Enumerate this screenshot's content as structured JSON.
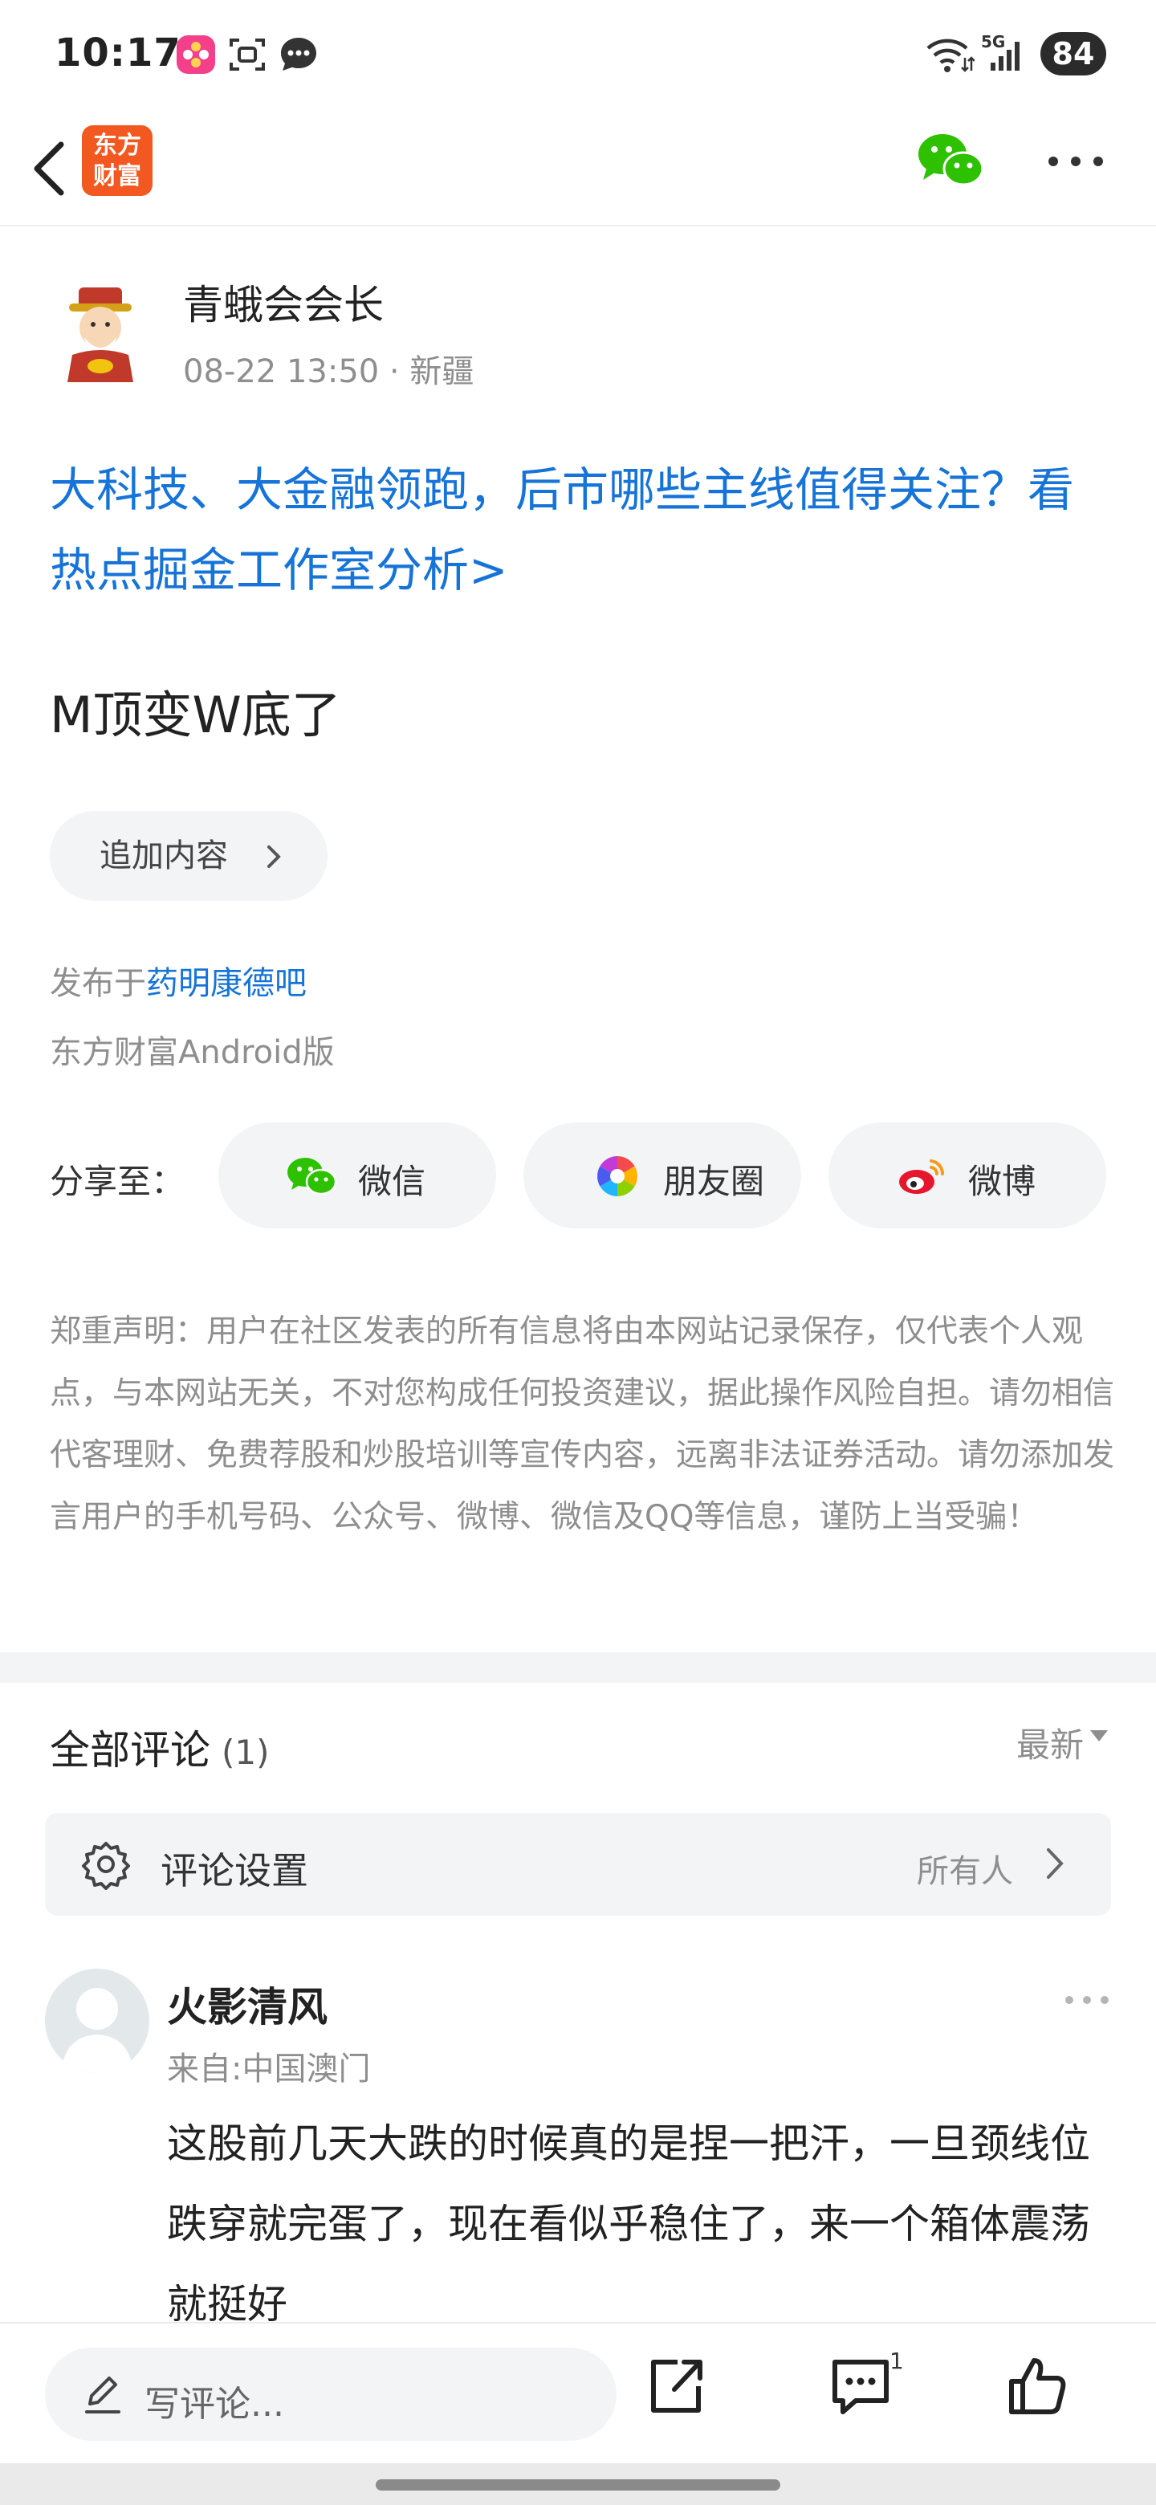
{
  "status_bar": {
    "time": "10:17",
    "network": "5G",
    "battery": "84"
  },
  "nav": {
    "brand_logo_text": "东方财富"
  },
  "post": {
    "author": "青蛾会会长",
    "meta": "08-22 13:50 · 新疆",
    "promo_link": "大科技、大金融领跑，后市哪些主线值得关注？看热点掘金工作室分析>",
    "text": "M顶变W底了",
    "add_content_label": "追加内容",
    "published_prefix": "发布于",
    "forum_name": "药明康德吧",
    "client": "东方财富Android版"
  },
  "share": {
    "label": "分享至：",
    "targets": [
      {
        "label": "微信",
        "icon": "wechat-icon"
      },
      {
        "label": "朋友圈",
        "icon": "moments-icon"
      },
      {
        "label": "微博",
        "icon": "weibo-icon"
      }
    ]
  },
  "disclaimer": "郑重声明：用户在社区发表的所有信息将由本网站记录保存，仅代表个人观点，与本网站无关，不对您构成任何投资建议，据此操作风险自担。请勿相信代客理财、免费荐股和炒股培训等宣传内容，远离非法证券活动。请勿添加发言用户的手机号码、公众号、微博、微信及QQ等信息，谨防上当受骗！",
  "comments": {
    "title": "全部评论",
    "count": "(1)",
    "sort_label": "最新",
    "settings_label": "评论设置",
    "settings_value": "所有人",
    "items": [
      {
        "name": "火影清风",
        "from": "来自:中国澳门",
        "text": "这股前几天大跌的时候真的是捏一把汗，一旦颈线位跌穿就完蛋了，现在看似乎稳住了，来一个箱体震荡就挺好"
      }
    ]
  },
  "bottom_bar": {
    "placeholder": "写评论...",
    "comment_count": "1"
  },
  "colors": {
    "accent_blue": "#1674d8",
    "brand_orange": "#f2581f",
    "wechat_green": "#2dc100",
    "muted_gray": "#8e8e8e",
    "panel_gray": "#f3f4f6"
  }
}
